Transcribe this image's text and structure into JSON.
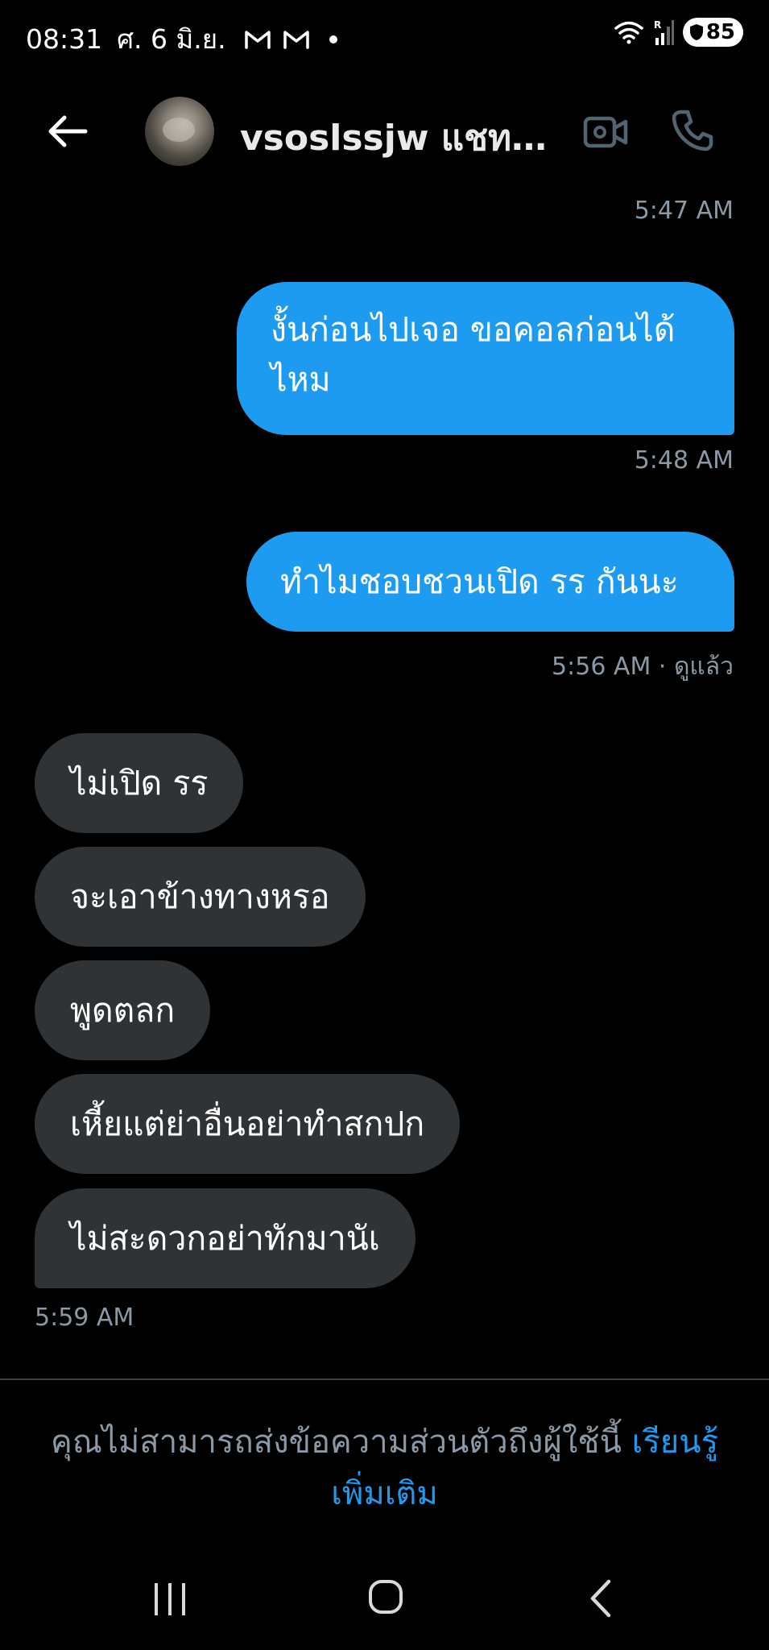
{
  "status_bar": {
    "time": "08:31",
    "date": "ศ. 6 มิ.ย.",
    "battery": "85"
  },
  "header": {
    "contact_name": "vsoslssjw แชทต..."
  },
  "messages": [
    {
      "type": "timestamp",
      "text": "5:47 AM"
    },
    {
      "type": "outgoing",
      "line1": "งั้นก่อนไปเจอ ขอคอลก่อนได้",
      "line2": "ไหม"
    },
    {
      "type": "timestamp",
      "text": "5:48 AM"
    },
    {
      "type": "outgoing",
      "line1": "ทำไมชอบชวนเปิด รร  กันนะ"
    },
    {
      "type": "timestamp",
      "text": "5:56 AM · ดูแล้ว"
    },
    {
      "type": "incoming",
      "text": "ไม่เปิด รร"
    },
    {
      "type": "incoming",
      "text": "จะเอาข้างทางหรอ"
    },
    {
      "type": "incoming",
      "text": "พูดตลก"
    },
    {
      "type": "incoming",
      "text": "เหี้ยแต่ย่าอื่นอย่าทำสกปก"
    },
    {
      "type": "incoming",
      "text": "ไม่สะดวกอย่าทักมานัเ"
    },
    {
      "type": "timestamp",
      "text": "5:59 AM"
    }
  ],
  "footer": {
    "notice_text": "คุณไม่สามารถส่งข้อความส่วนตัวถึงผู้ใช้นี้ ",
    "learn_more_link": "เรียนรู้เพิ่มเติม"
  },
  "colors": {
    "background": "#000000",
    "outgoing_bubble": "#1d9bf0",
    "incoming_bubble": "#2f3336",
    "muted_text": "#8b98a5",
    "link": "#1d9bf0"
  },
  "icons": {
    "back": "arrow-left-icon",
    "video": "video-camera-icon",
    "call": "phone-icon",
    "mail": "gmail-icon",
    "wifi": "wifi-icon",
    "signal": "signal-icon",
    "battery": "battery-shield-icon",
    "nav_recent": "recent-apps-icon",
    "nav_home": "home-icon",
    "nav_back": "nav-back-icon"
  }
}
